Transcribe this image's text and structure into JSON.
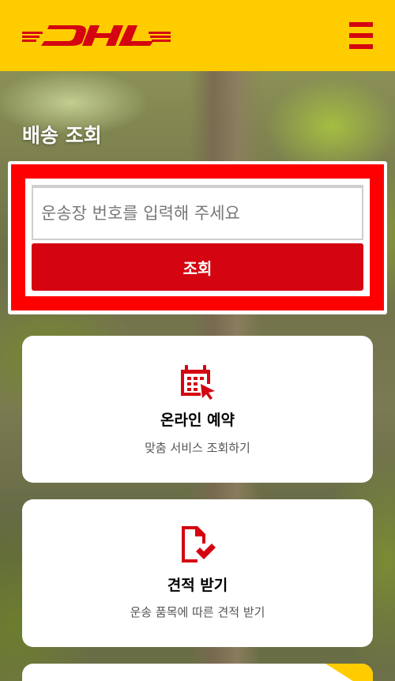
{
  "header": {
    "logo_text": "DHL",
    "brand_yellow": "#ffcc00",
    "brand_red": "#d40511"
  },
  "tracking": {
    "title": "배송 조회",
    "input_placeholder": "운송장 번호를 입력해 주세요",
    "input_value": "",
    "button_label": "조회"
  },
  "cards": [
    {
      "icon": "calendar-cursor-icon",
      "title": "온라인 예약",
      "description": "맞춤 서비스 조회하기"
    },
    {
      "icon": "document-check-icon",
      "title": "견적 받기",
      "description": "운송 품목에 따른 견적 받기"
    }
  ]
}
